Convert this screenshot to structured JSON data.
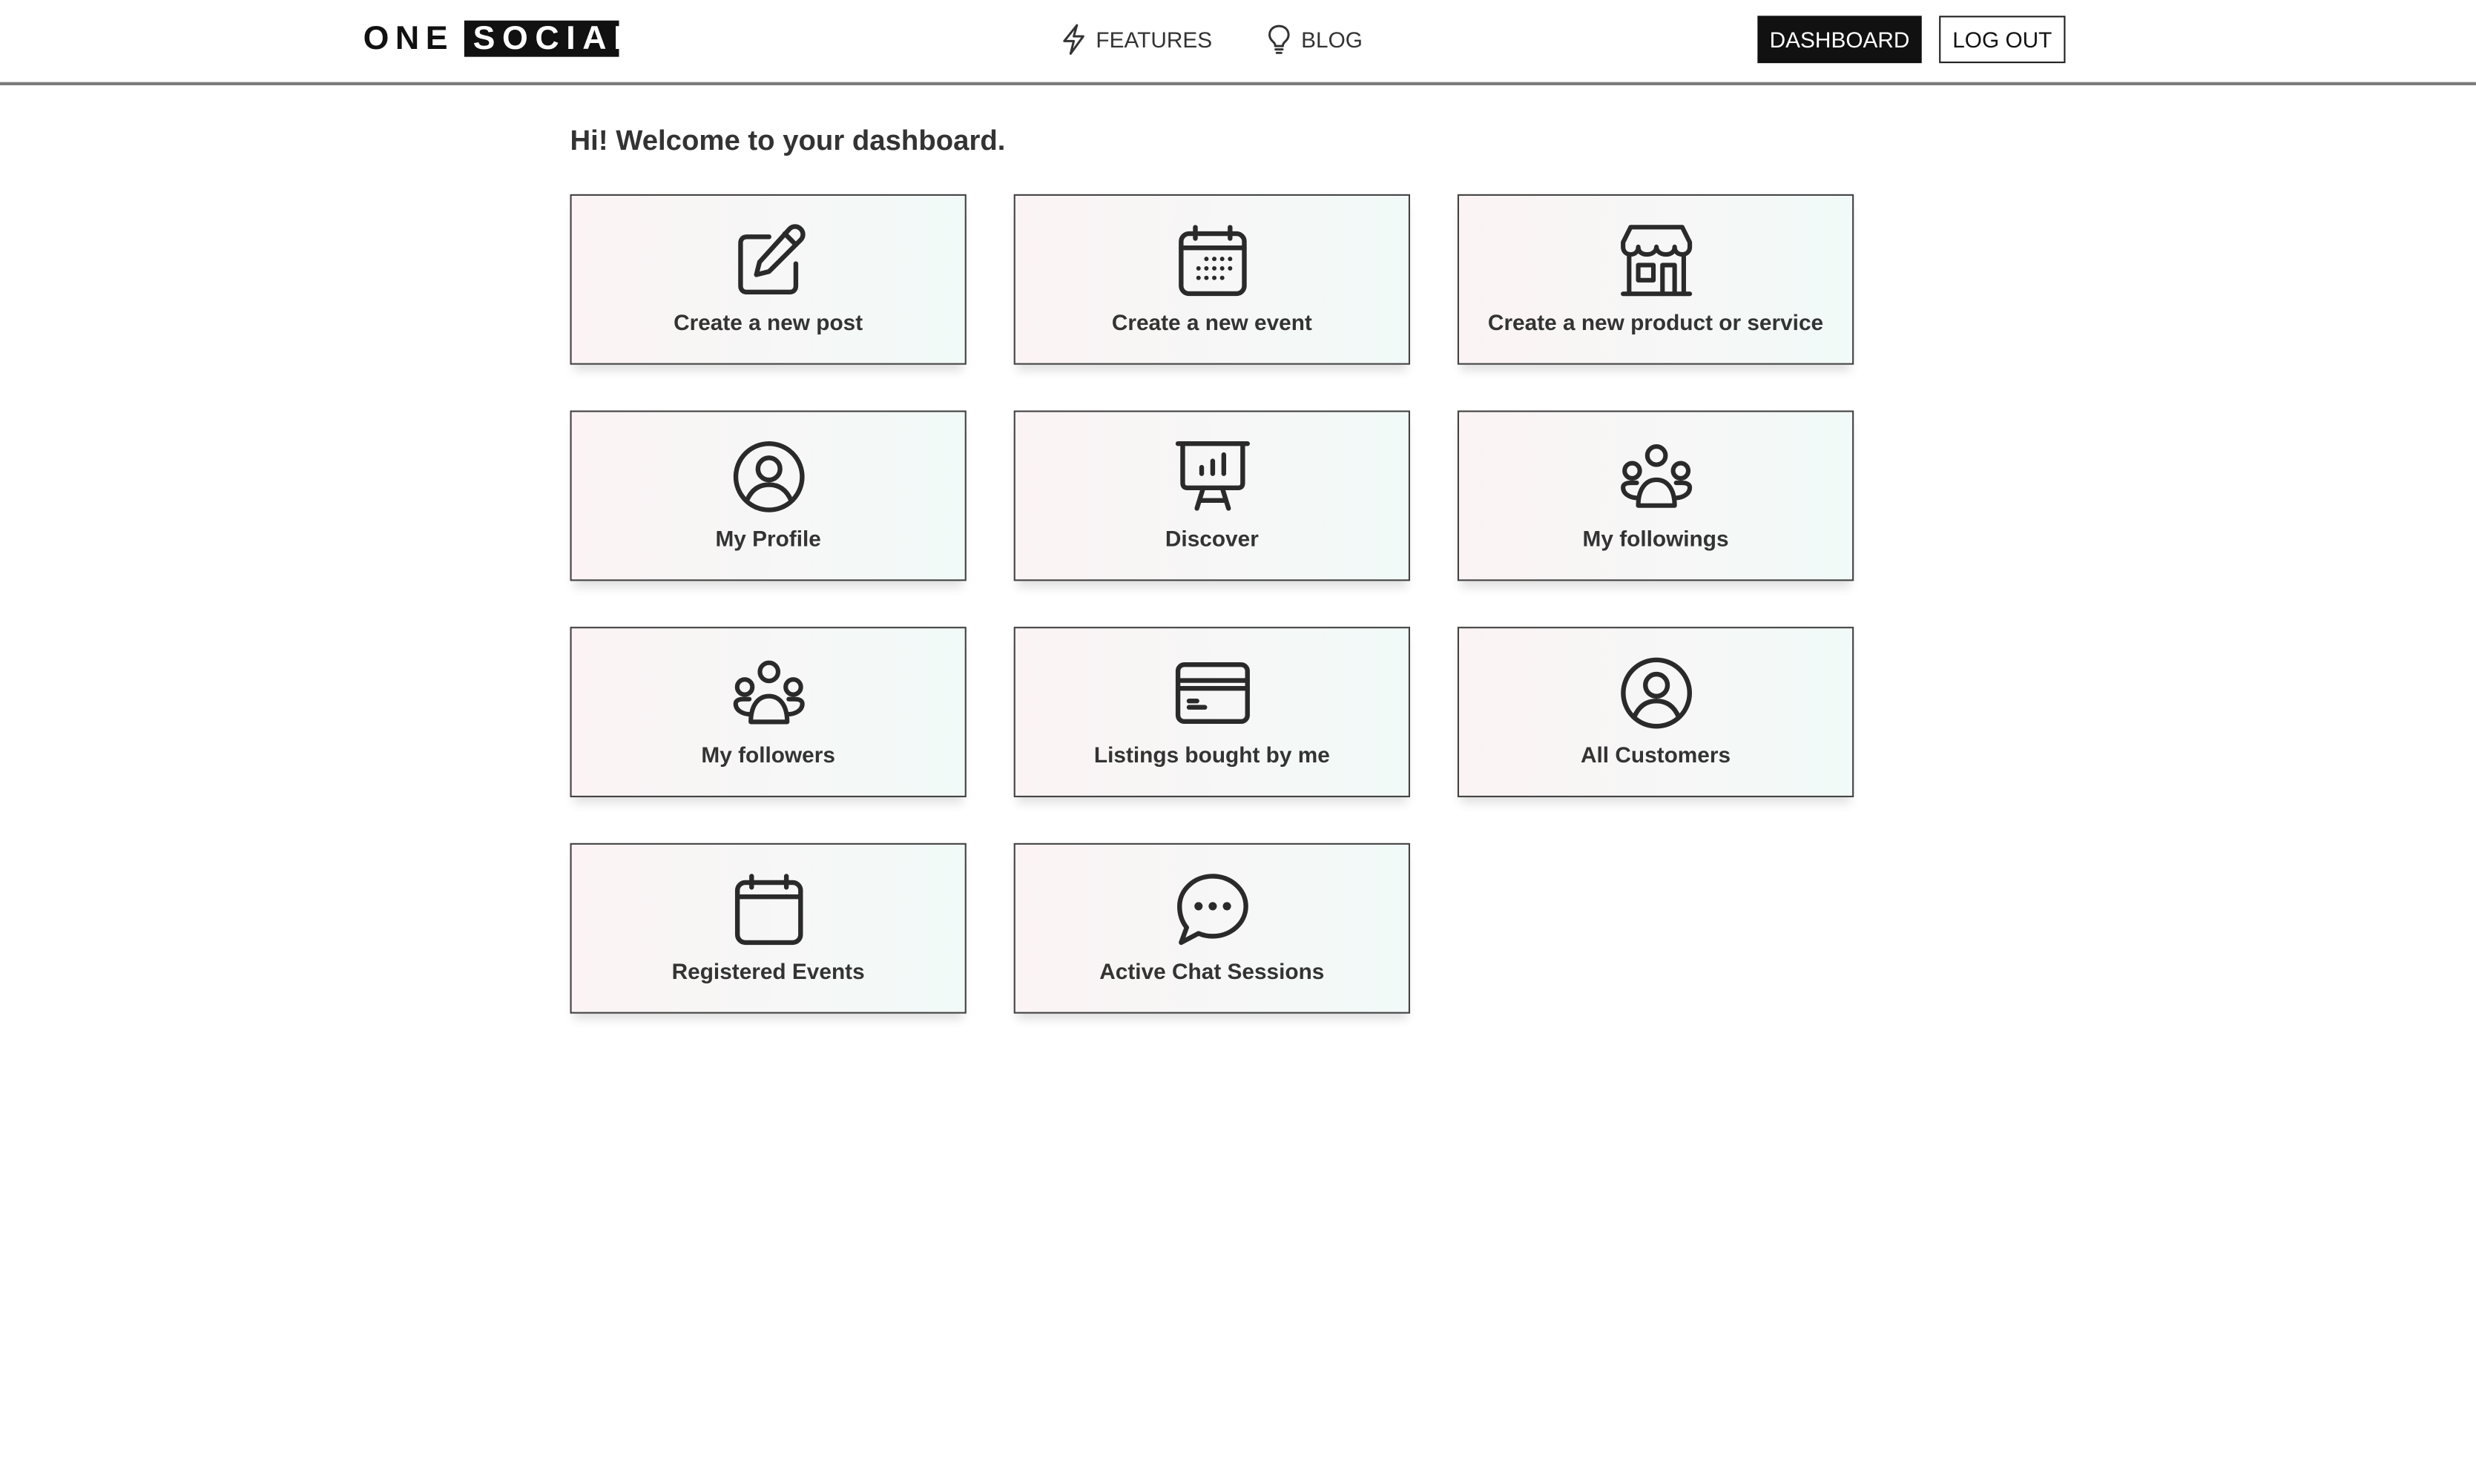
{
  "header": {
    "logo": {
      "word1": "ONE",
      "word2": "SOCIAL"
    },
    "nav": [
      {
        "label": "FEATURES",
        "icon": "lightning-icon"
      },
      {
        "label": "BLOG",
        "icon": "lightbulb-icon"
      }
    ],
    "dashboard_label": "DASHBOARD",
    "logout_label": "LOG OUT"
  },
  "main": {
    "welcome": "Hi! Welcome to your dashboard.",
    "cards": [
      {
        "label": "Create a new post",
        "icon": "edit-icon"
      },
      {
        "label": "Create a new event",
        "icon": "calendar-event-icon"
      },
      {
        "label": "Create a new product or service",
        "icon": "store-icon"
      },
      {
        "label": "My Profile",
        "icon": "user-circle-icon"
      },
      {
        "label": "Discover",
        "icon": "presentation-chart-icon"
      },
      {
        "label": "My followings",
        "icon": "users-group-icon"
      },
      {
        "label": "My followers",
        "icon": "users-group-icon"
      },
      {
        "label": "Listings bought by me",
        "icon": "credit-card-icon"
      },
      {
        "label": "All Customers",
        "icon": "user-circle-icon"
      },
      {
        "label": "Registered Events",
        "icon": "calendar-icon"
      },
      {
        "label": "Active Chat Sessions",
        "icon": "chat-bubble-icon"
      }
    ]
  },
  "colors": {
    "text": "#222222",
    "button_dark": "#111111",
    "card_gradient_start": "#fbf3f4",
    "card_gradient_end": "#f1faf8"
  }
}
